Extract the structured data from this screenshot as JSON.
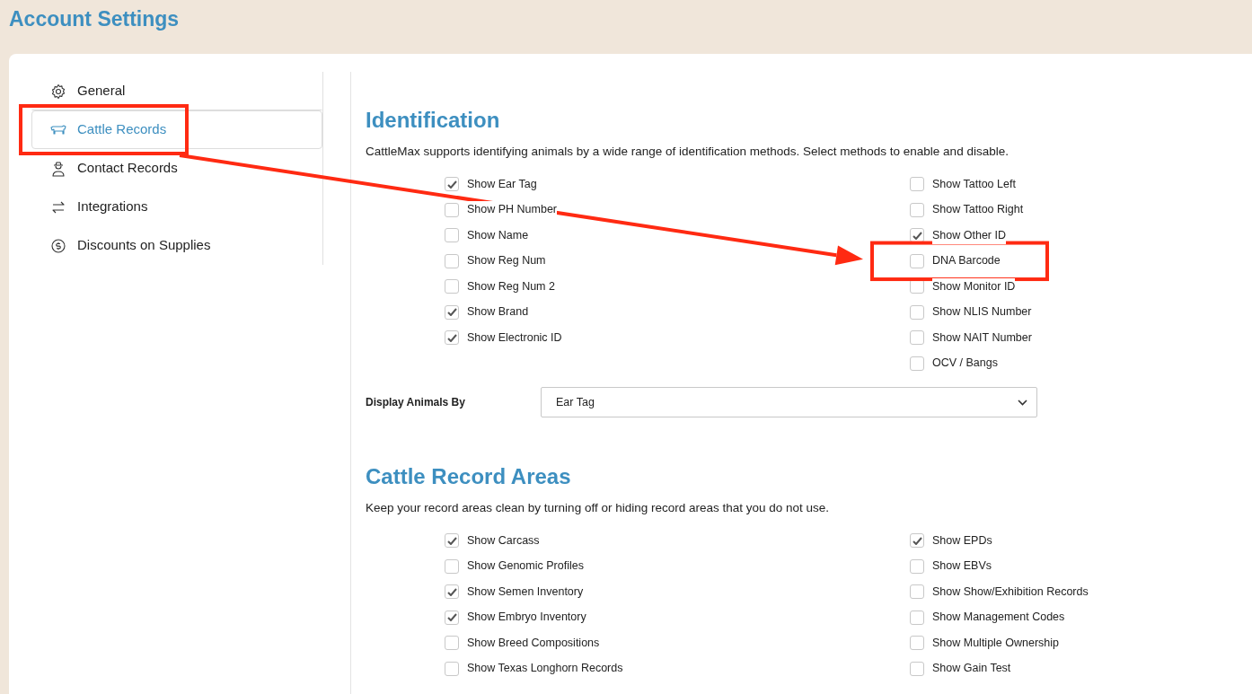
{
  "page_title": "Account Settings",
  "sidebar": {
    "items": [
      {
        "label": "General",
        "selected": false,
        "highlighted": false
      },
      {
        "label": "Cattle Records",
        "selected": true,
        "highlighted": true
      },
      {
        "label": "Contact Records",
        "selected": false,
        "highlighted": false
      },
      {
        "label": "Integrations",
        "selected": false,
        "highlighted": false
      },
      {
        "label": "Discounts on Supplies",
        "selected": false,
        "highlighted": false
      }
    ]
  },
  "identification": {
    "title": "Identification",
    "description": "CattleMax supports identifying animals by a wide range of identification methods. Select methods to enable and disable.",
    "left_options": [
      {
        "label": "Show Ear Tag",
        "checked": true
      },
      {
        "label": "Show PH Number",
        "checked": false
      },
      {
        "label": "Show Name",
        "checked": false
      },
      {
        "label": "Show Reg Num",
        "checked": false
      },
      {
        "label": "Show Reg Num 2",
        "checked": false
      },
      {
        "label": "Show Brand",
        "checked": true
      },
      {
        "label": "Show Electronic ID",
        "checked": true
      }
    ],
    "right_options": [
      {
        "label": "Show Tattoo Left",
        "checked": false,
        "highlighted": false
      },
      {
        "label": "Show Tattoo Right",
        "checked": false,
        "highlighted": false
      },
      {
        "label": "Show Other ID",
        "checked": true,
        "highlighted": false
      },
      {
        "label": "DNA Barcode",
        "checked": false,
        "highlighted": true
      },
      {
        "label": "Show Monitor ID",
        "checked": false,
        "highlighted": false
      },
      {
        "label": "Show NLIS Number",
        "checked": false,
        "highlighted": false
      },
      {
        "label": "Show NAIT Number",
        "checked": false,
        "highlighted": false
      },
      {
        "label": "OCV / Bangs",
        "checked": false,
        "highlighted": false
      }
    ],
    "display_by": {
      "label": "Display Animals By",
      "value": "Ear Tag"
    }
  },
  "record_areas": {
    "title": "Cattle Record Areas",
    "description": "Keep your record areas clean by turning off or hiding record areas that you do not use.",
    "left_options": [
      {
        "label": "Show Carcass",
        "checked": true
      },
      {
        "label": "Show Genomic Profiles",
        "checked": false
      },
      {
        "label": "Show Semen Inventory",
        "checked": true
      },
      {
        "label": "Show Embryo Inventory",
        "checked": true
      },
      {
        "label": "Show Breed Compositions",
        "checked": false
      },
      {
        "label": "Show Texas Longhorn Records",
        "checked": false
      }
    ],
    "right_options": [
      {
        "label": "Show EPDs",
        "checked": true
      },
      {
        "label": "Show EBVs",
        "checked": false
      },
      {
        "label": "Show Show/Exhibition Records",
        "checked": false
      },
      {
        "label": "Show Management Codes",
        "checked": false
      },
      {
        "label": "Show Multiple Ownership",
        "checked": false
      },
      {
        "label": "Show Gain Test",
        "checked": false
      }
    ]
  }
}
